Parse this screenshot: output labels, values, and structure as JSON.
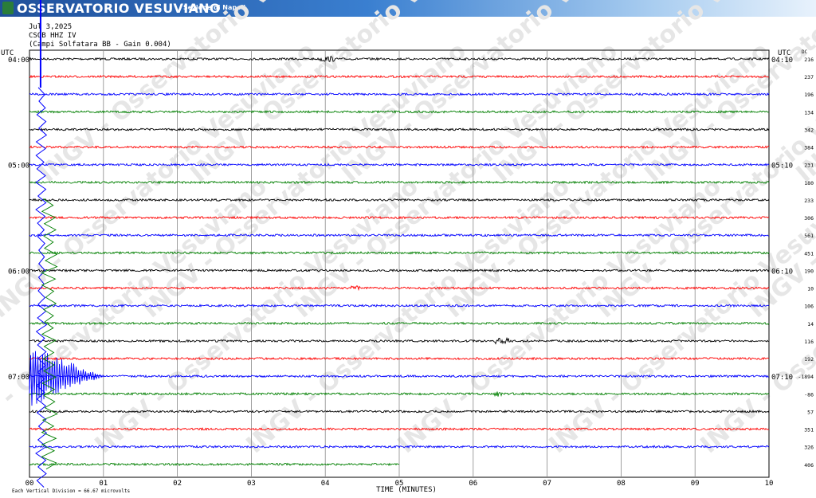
{
  "banner": {
    "title": "OSSERVATORIO VESUVIANO",
    "section": "Sezione di Napoli",
    "logo_text": "INGV"
  },
  "header": {
    "date": "Jul 3,2025",
    "station": "CSOB HHZ IV",
    "description": "(Campi Solfatara BB  - Gain 0.004)"
  },
  "chart_data": {
    "type": "line",
    "title": "",
    "xlabel": "TIME (MINUTES)",
    "x_ticks": [
      "00",
      "01",
      "02",
      "03",
      "04",
      "05",
      "06",
      "07",
      "08",
      "09",
      "10"
    ],
    "xlim": [
      0,
      10
    ],
    "left_axis_unit": "UTC",
    "right_axis_unit": "UTC",
    "dc_label": "DC",
    "left_hour_labels": [
      {
        "row": 0,
        "text": "04:00"
      },
      {
        "row": 6,
        "text": "05:00"
      },
      {
        "row": 12,
        "text": "06:00"
      },
      {
        "row": 18,
        "text": "07:00"
      }
    ],
    "right_hour_labels": [
      {
        "row": 0,
        "text": "04:10"
      },
      {
        "row": 6,
        "text": "05:10"
      },
      {
        "row": 12,
        "text": "06:10"
      },
      {
        "row": 18,
        "text": "07:10"
      }
    ],
    "trace_colors": [
      "#000000",
      "#ff0000",
      "#0000ff",
      "#007f00"
    ],
    "dc_values": [
      "216",
      "237",
      "196",
      "134",
      "342",
      "384",
      "231",
      "180",
      "233",
      "306",
      "561",
      "451",
      "190",
      "10",
      "106",
      "14",
      "116",
      "192",
      "-1894",
      "-86",
      "57",
      "351",
      "326",
      "406"
    ],
    "last_trace_end_minute": 5.0,
    "event": {
      "start_minute": 0.15,
      "start_row": 0,
      "peak_rows": [
        10,
        24
      ],
      "coda_end_minute": 1.0,
      "coda_row": 18
    },
    "scale_note": "Each Vertical Division = 66.67 microvolts",
    "watermark": "INGV - Osservatorio Vesuviano",
    "grid": true
  }
}
